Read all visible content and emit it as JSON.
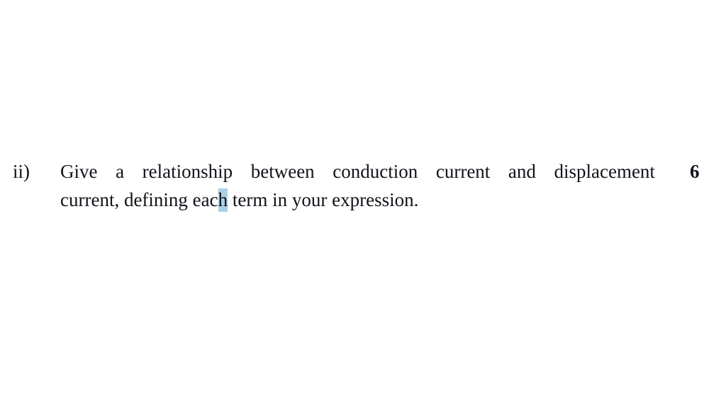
{
  "document": {
    "background_color": "#ffffff",
    "text_color": "#12131a",
    "highlight_color": "#aacfe8"
  },
  "question": {
    "item_label": "ii)",
    "marks": "6",
    "full_text": "Give a relationship between conduction current and displacement current, defining each term in your expression.",
    "line1_words": [
      "Give",
      "a",
      "relationship",
      "between",
      "conduction",
      "current",
      "and",
      "displacement"
    ],
    "line2": {
      "before_highlight": "current, defining eac",
      "highlighted": "h",
      "after_highlight": " term in your expression."
    }
  }
}
